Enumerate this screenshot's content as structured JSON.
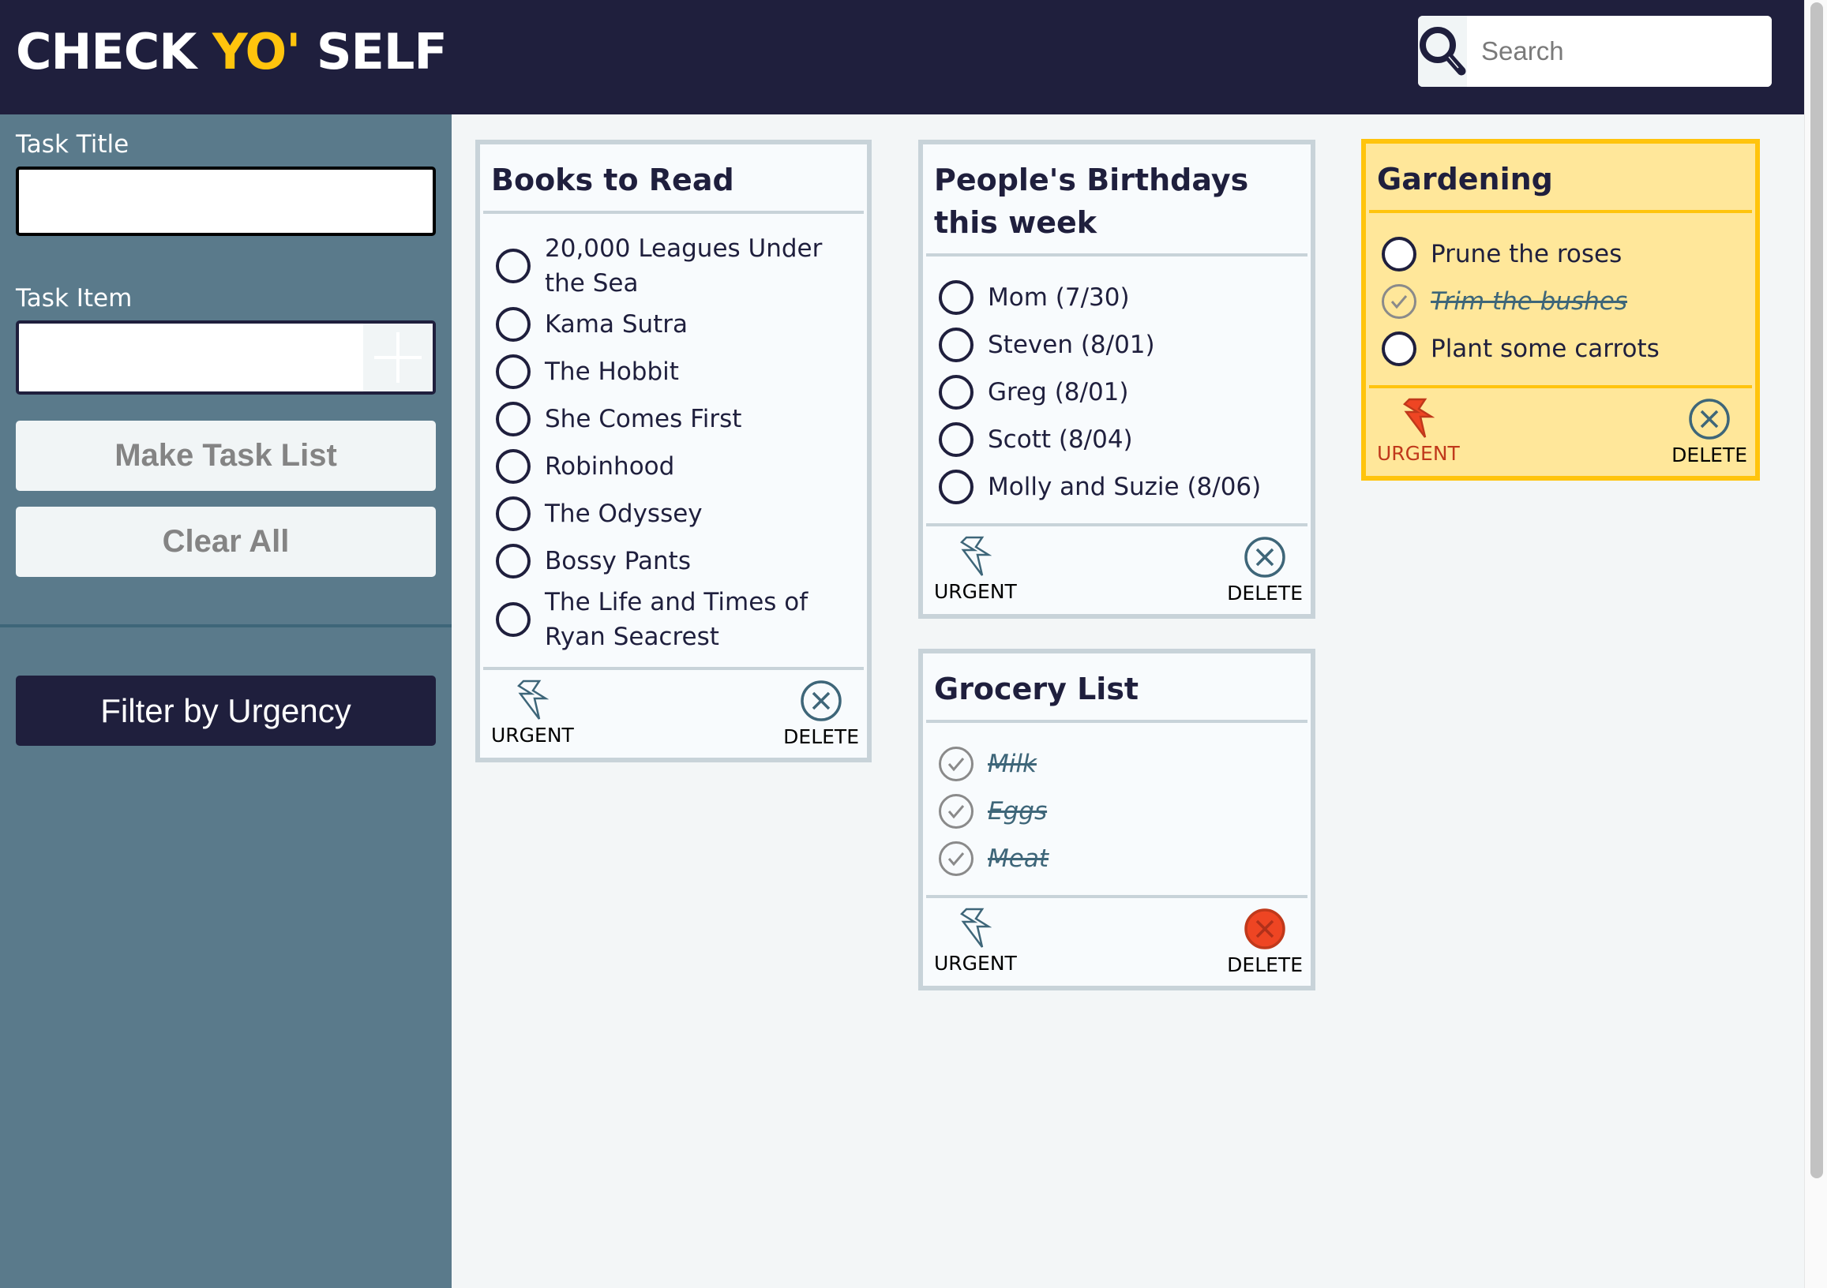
{
  "header": {
    "logo_part1": "CHECK ",
    "logo_accent": "YO'",
    "logo_part2": " SELF",
    "search_placeholder": "Search",
    "search_icon": "magnifier-icon"
  },
  "sidebar": {
    "task_title_label": "Task Title",
    "task_title_value": "",
    "task_item_label": "Task Item",
    "task_item_value": "",
    "add_icon": "plus-icon",
    "make_task_list_label": "Make Task List",
    "clear_all_label": "Clear All",
    "filter_label": "Filter by Urgency"
  },
  "colors": {
    "navy": "#1f1f3d",
    "accent_yellow": "#ffc40d",
    "sidebar": "#5a7a8b",
    "urgent_bg": "#ffe79a",
    "danger": "#ee4523",
    "teal": "#3e6679"
  },
  "cards": [
    {
      "title": "Books to Read",
      "urgent": false,
      "delete_active": false,
      "items": [
        {
          "text": "20,000 Leagues Under the Sea",
          "done": false
        },
        {
          "text": "Kama Sutra",
          "done": false
        },
        {
          "text": "The Hobbit",
          "done": false
        },
        {
          "text": "She Comes First",
          "done": false
        },
        {
          "text": "Robinhood",
          "done": false
        },
        {
          "text": "The Odyssey",
          "done": false
        },
        {
          "text": "Bossy Pants",
          "done": false
        },
        {
          "text": "The Life and Times of Ryan Seacrest",
          "done": false
        }
      ],
      "urgent_label": "URGENT",
      "delete_label": "DELETE"
    },
    {
      "title": "People's Birthdays this week",
      "urgent": false,
      "delete_active": false,
      "items": [
        {
          "text": "Mom (7/30)",
          "done": false
        },
        {
          "text": "Steven (8/01)",
          "done": false
        },
        {
          "text": "Greg (8/01)",
          "done": false
        },
        {
          "text": "Scott (8/04)",
          "done": false
        },
        {
          "text": "Molly and Suzie (8/06)",
          "done": false
        }
      ],
      "urgent_label": "URGENT",
      "delete_label": "DELETE"
    },
    {
      "title": "Grocery List",
      "urgent": false,
      "delete_active": true,
      "items": [
        {
          "text": "Milk",
          "done": true
        },
        {
          "text": "Eggs",
          "done": true
        },
        {
          "text": "Meat",
          "done": true
        }
      ],
      "urgent_label": "URGENT",
      "delete_label": "DELETE"
    },
    {
      "title": "Gardening",
      "urgent": true,
      "delete_active": false,
      "items": [
        {
          "text": "Prune the roses",
          "done": false
        },
        {
          "text": "Trim the bushes",
          "done": true
        },
        {
          "text": "Plant some carrots",
          "done": false
        }
      ],
      "urgent_label": "URGENT",
      "delete_label": "DELETE"
    }
  ]
}
